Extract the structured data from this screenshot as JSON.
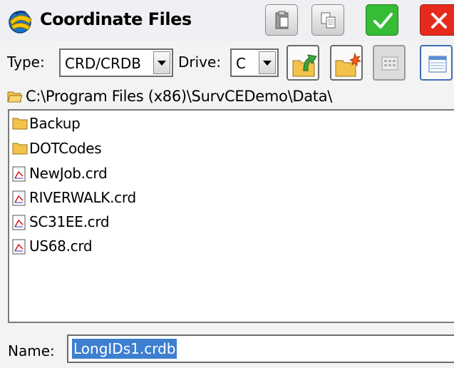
{
  "window": {
    "title": "Coordinate Files",
    "buttons": [
      {
        "name": "paste-icon"
      },
      {
        "name": "copy-icon"
      },
      {
        "name": "checkmark-icon"
      },
      {
        "name": "close-icon"
      }
    ]
  },
  "toolbar": {
    "type_label": "Type:",
    "type_value": "CRD/CRDB",
    "drive_label": "Drive:",
    "drive_value": "C",
    "icons": [
      "folder-up-icon",
      "new-folder-icon",
      "list-view-icon",
      "details-view-icon"
    ]
  },
  "path": {
    "text": "C:\\Program Files (x86)\\SurvCEDemo\\Data\\"
  },
  "files": [
    {
      "name": "Backup",
      "kind": "folder"
    },
    {
      "name": "DOTCodes",
      "kind": "folder"
    },
    {
      "name": "NewJob.crd",
      "kind": "file"
    },
    {
      "name": "RIVERWALK.crd",
      "kind": "file"
    },
    {
      "name": "SC31EE.crd",
      "kind": "file"
    },
    {
      "name": "US68.crd",
      "kind": "file"
    }
  ],
  "name_field": {
    "label": "Name:",
    "value": "LongIDs1.crdb"
  },
  "colors": {
    "ok": "#35bd35",
    "cancel": "#e62a1c",
    "selection": "#3d7fd0",
    "folder": "#f2c24a"
  }
}
